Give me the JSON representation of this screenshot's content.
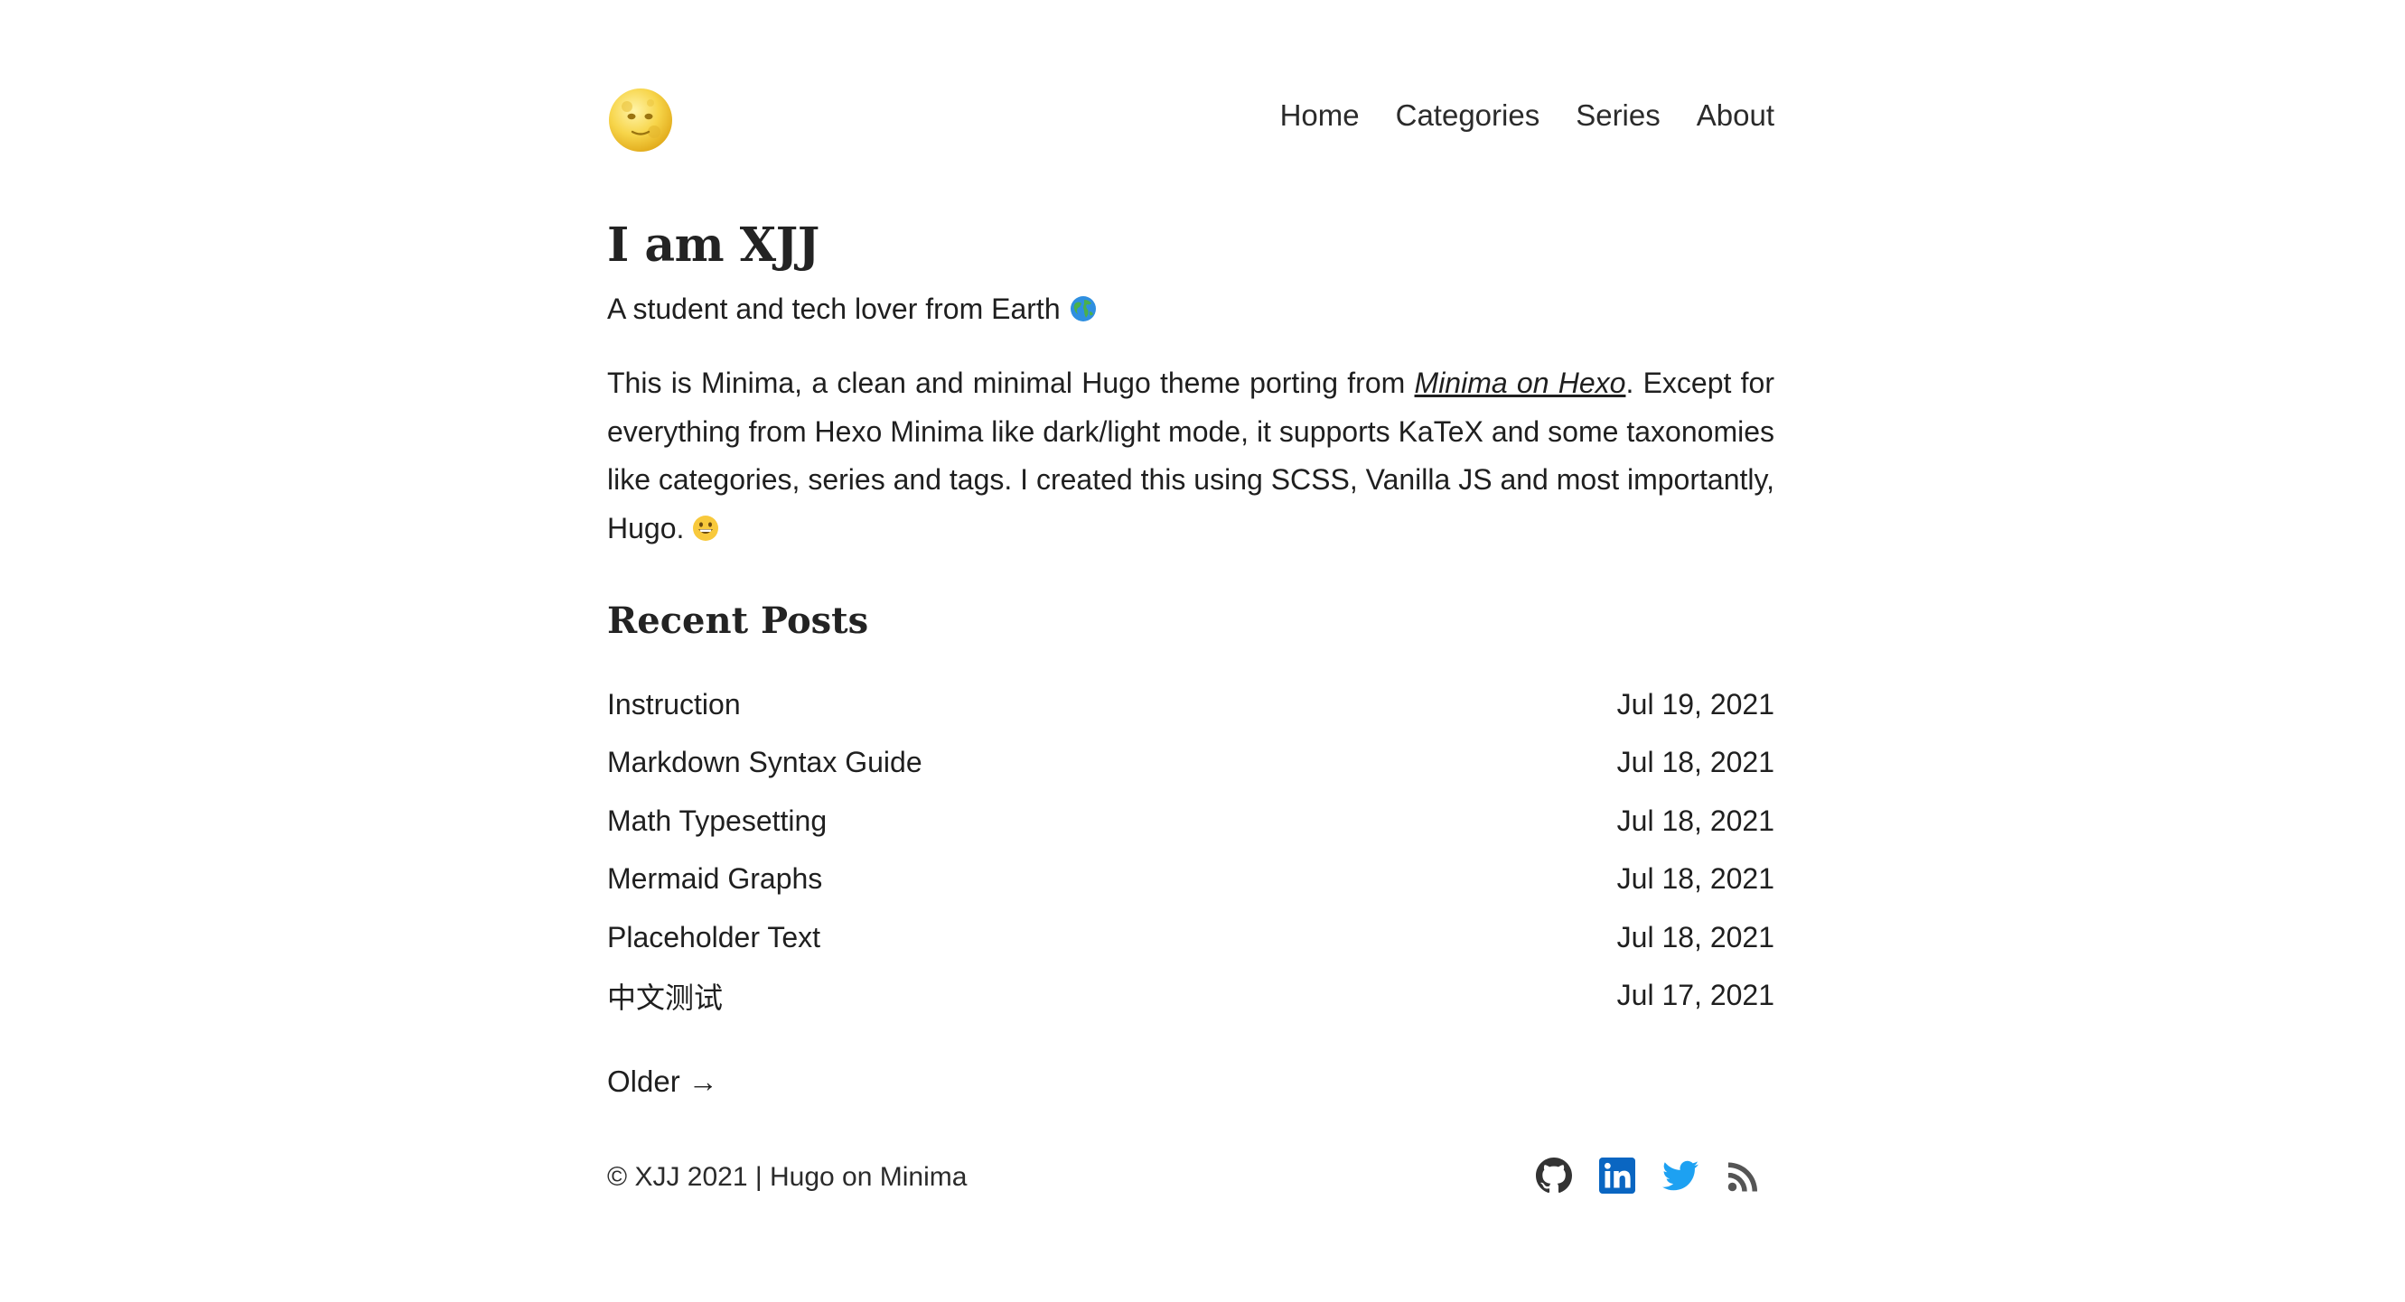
{
  "header": {
    "logo_icon": "full-moon-face-icon",
    "nav": [
      {
        "label": "Home"
      },
      {
        "label": "Categories"
      },
      {
        "label": "Series"
      },
      {
        "label": "About"
      }
    ]
  },
  "intro": {
    "title": "I am XJJ",
    "subtitle": "A student and tech lover from Earth",
    "subtitle_icon": "globe-icon",
    "text_before_link": "This is Minima, a clean and minimal Hugo theme porting from ",
    "link_text": "Minima on Hexo",
    "text_after_link": ". Except for everything from Hexo Minima like dark/light mode, it supports KaTeX and some taxonomies like categories, series and tags. I created this using SCSS, Vanilla JS and most importantly, Hugo.",
    "trailing_icon": "grinning-face-icon"
  },
  "recent_posts": {
    "heading": "Recent Posts",
    "posts": [
      {
        "title": "Instruction",
        "date": "Jul 19, 2021"
      },
      {
        "title": "Markdown Syntax Guide",
        "date": "Jul 18, 2021"
      },
      {
        "title": "Math Typesetting",
        "date": "Jul 18, 2021"
      },
      {
        "title": "Mermaid Graphs",
        "date": "Jul 18, 2021"
      },
      {
        "title": "Placeholder Text",
        "date": "Jul 18, 2021"
      },
      {
        "title": "中文测试",
        "date": "Jul 17, 2021"
      }
    ],
    "older_label": "Older →"
  },
  "footer": {
    "copyright": "© XJJ 2021 | Hugo on Minima",
    "socials": [
      {
        "icon": "github-icon",
        "color": "#333333"
      },
      {
        "icon": "linkedin-icon",
        "color": "#0A66C2"
      },
      {
        "icon": "twitter-icon",
        "color": "#1DA1F2"
      },
      {
        "icon": "rss-icon",
        "color": "#555555"
      }
    ]
  }
}
